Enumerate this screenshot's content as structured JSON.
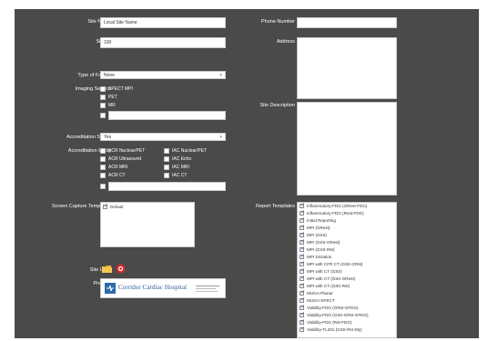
{
  "form": {
    "site_name": {
      "label": "Site Name",
      "value": "Local Site Name"
    },
    "site_id": {
      "label": "Site ID",
      "value": "100"
    },
    "phone_number": {
      "label": "Phone Number",
      "value": ""
    },
    "address": {
      "label": "Address",
      "value": ""
    },
    "type_of_facility": {
      "label": "Type of Facility",
      "value": "None"
    },
    "imaging_service": {
      "label": "Imaging Service",
      "options": [
        {
          "label": "SPECT MPI",
          "checked": false
        },
        {
          "label": "PET",
          "checked": false
        },
        {
          "label": "MR",
          "checked": false
        }
      ],
      "other_value": ""
    },
    "site_description": {
      "label": "Site Description",
      "value": ""
    },
    "accreditation_status": {
      "label": "Accreditation Status",
      "value": "Yes"
    },
    "accreditation_entity": {
      "label": "Accreditation Entity",
      "options": [
        {
          "label": "ACR Nuclear/PET",
          "checked": false
        },
        {
          "label": "IAC Nuclear/PET",
          "checked": false
        },
        {
          "label": "ACR Ultrasound",
          "checked": false
        },
        {
          "label": "IAC Echo",
          "checked": false
        },
        {
          "label": "ACR MRI",
          "checked": false
        },
        {
          "label": "IAC MRI",
          "checked": false
        },
        {
          "label": "ACR CT",
          "checked": false
        },
        {
          "label": "IAC CT",
          "checked": false
        }
      ],
      "other_value": ""
    },
    "screen_capture_templates": {
      "label": "Screen Capture Templates",
      "items": [
        {
          "label": "Default",
          "checked": true
        }
      ]
    },
    "report_templates": {
      "label": "Report Templates",
      "items": [
        {
          "label": "Inflammatory-FDG (GRest-FDG)",
          "checked": true
        },
        {
          "label": "Inflammatory-FDG (Rest-FDG)",
          "checked": true
        },
        {
          "label": "Initial Reporting",
          "checked": true
        },
        {
          "label": "MPI (GRest)",
          "checked": true
        },
        {
          "label": "MPI (GStr)",
          "checked": true
        },
        {
          "label": "MPI (GStr-GRest)",
          "checked": true
        },
        {
          "label": "MPI (GStr-Rst)",
          "checked": true
        },
        {
          "label": "MPI Dictation",
          "checked": true
        },
        {
          "label": "MPI with CFR CT (GStr-GRst)",
          "checked": true
        },
        {
          "label": "MPI with CT (GStr)",
          "checked": true
        },
        {
          "label": "MPI with CT (GStr-GRest)",
          "checked": true
        },
        {
          "label": "MPI with CT (GStr-Rst)",
          "checked": true
        },
        {
          "label": "MUGA-Planar",
          "checked": true
        },
        {
          "label": "MUGA-SPECT",
          "checked": true
        },
        {
          "label": "Viability-FDG (GRst-GFDG)",
          "checked": true
        },
        {
          "label": "Viability-FDG (GStr-GRst-GFDG)",
          "checked": true
        },
        {
          "label": "Viability-FDG (Rst-FDG)",
          "checked": true
        },
        {
          "label": "Viability-TL201 (GStr-Rst-Dly)",
          "checked": true
        }
      ]
    },
    "site_logo": {
      "label": "Site Logo",
      "folder_icon": "folder-icon",
      "remove_icon": "remove-icon"
    },
    "preview": {
      "label": "Preview",
      "logo_text": "Corridor Cardiac Hospital"
    }
  },
  "colors": {
    "panel_bg": "#4a4a4a",
    "label_text": "#ffffff",
    "check_blue": "#2a5da8"
  }
}
